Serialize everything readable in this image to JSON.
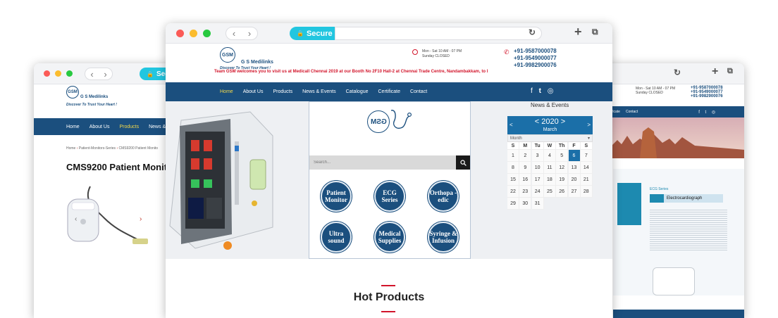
{
  "left_window": {
    "secure_label": "Secu",
    "logo_text": "GSM",
    "brand": "G S Medilinks",
    "tagline": "Discover To Trust Your Heart !",
    "nav": [
      "Home",
      "About Us",
      "Products",
      "News & Ev"
    ],
    "breadcrumb": [
      "Home",
      "Patient-Monitors-Series",
      "CMS9200 Patient Monito"
    ],
    "product_title": "CMS9200 Patient Monito"
  },
  "main_window": {
    "secure_label": "Secure",
    "logo_text": "GSM",
    "brand": "G S Medilinks",
    "tagline": "Discover To Trust Your Heart !",
    "hours_line1": "Mon - Sat 10 AM - 07 PM",
    "hours_line2": "Sunday CLOSED",
    "phones": [
      "+91-9587000078",
      "+91-9549000077",
      "+91-9982900076"
    ],
    "marquee": "Team GSM welcomes you to visit us at Medicall Chennai 2019 at our Booth No 2F10 Hall-2 at Chennai Trade Centre, Nandambakkam, to l",
    "nav": [
      "Home",
      "About Us",
      "Products",
      "News & Events",
      "Catalogue",
      "Certificate",
      "Contact"
    ],
    "social": [
      "f",
      "t",
      "ig"
    ],
    "search_placeholder": "Search...",
    "categories": [
      "Patient Monitor",
      "ECG Series",
      "Orthopa -edic",
      "Ultra sound",
      "Medical Supplies",
      "Syringe & Infusion"
    ],
    "news_title": "News & Events",
    "calendar": {
      "year": "< 2020 >",
      "month": "March",
      "select_label": "Month",
      "days": [
        "S",
        "M",
        "Tu",
        "W",
        "Th",
        "F",
        "S"
      ],
      "dates": [
        "1",
        "2",
        "3",
        "4",
        "5",
        "6",
        "7",
        "8",
        "9",
        "10",
        "11",
        "12",
        "13",
        "14",
        "15",
        "16",
        "17",
        "18",
        "19",
        "20",
        "21",
        "22",
        "23",
        "24",
        "25",
        "26",
        "27",
        "28",
        "29",
        "30",
        "31"
      ],
      "today": "6"
    },
    "hot_products": "Hot Products"
  },
  "right_window": {
    "hours_line1": "Mon - Sat 10 AM - 07 PM",
    "hours_line2": "Sunday CLOSED",
    "phones": [
      "+91-9587000078",
      "+91-9549000077",
      "+91-9982900076"
    ],
    "nav": [
      "ficate",
      "Contact"
    ],
    "ecg_series": "ECG Series",
    "product_name": "Electrocardiograph"
  }
}
